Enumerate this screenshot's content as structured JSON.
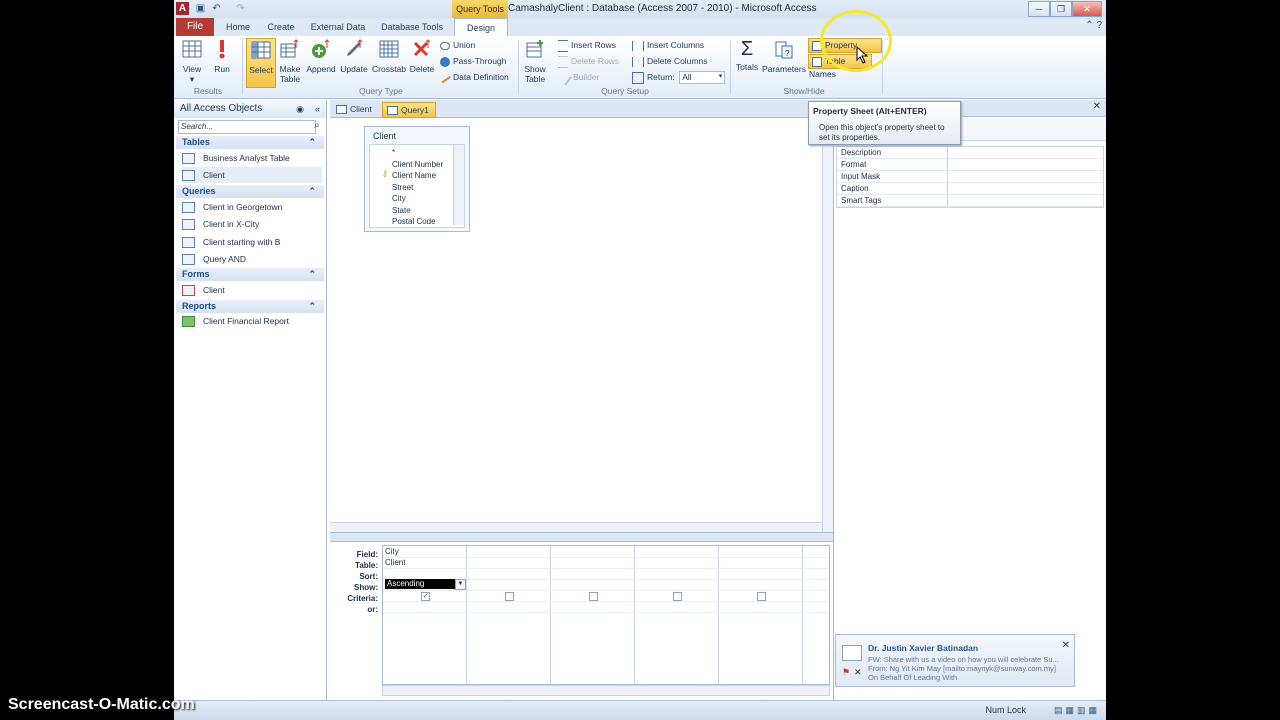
{
  "titlebar": {
    "app_letter": "A",
    "context_tab_header": "Query Tools",
    "window_title": "CamashalyClient : Database (Access 2007 - 2010) - Microsoft Access",
    "qat_save": "▣",
    "qat_undo": "↶",
    "qat_redo": "↷",
    "minimize": "─",
    "maximize": "❐",
    "close": "✕"
  },
  "tabs": {
    "file": "File",
    "items": [
      "Home",
      "Create",
      "External Data",
      "Database Tools",
      "Design"
    ]
  },
  "ribbon": {
    "results": {
      "label": "Results",
      "view": "View",
      "run": "Run"
    },
    "query_type": {
      "label": "Query Type",
      "select": "Select",
      "make_table_1": "Make",
      "make_table_2": "Table",
      "append": "Append",
      "update": "Update",
      "crosstab": "Crosstab",
      "delete": "Delete",
      "union": "Union",
      "pass_through": "Pass-Through",
      "data_definition": "Data Definition"
    },
    "query_setup": {
      "label": "Query Setup",
      "show_table_1": "Show",
      "show_table_2": "Table",
      "insert_rows": "Insert Rows",
      "delete_rows": "Delete Rows",
      "builder": "Builder",
      "insert_columns": "Insert Columns",
      "delete_columns": "Delete Columns",
      "return_label": "Return:",
      "return_value": "All"
    },
    "show_hide": {
      "label": "Show/Hide",
      "totals": "Totals",
      "parameters": "Parameters",
      "property_sheet": "Property Sheet",
      "table_names": "Table Names"
    }
  },
  "tooltip": {
    "title": "Property Sheet (Alt+ENTER)",
    "description": "Open this object's property sheet to set its properties."
  },
  "nav": {
    "header": "All Access Objects",
    "search_placeholder": "Search...",
    "groups": {
      "tables": "Tables",
      "queries": "Queries",
      "forms": "Forms",
      "reports": "Reports"
    },
    "tables": [
      "Business Analyst Table",
      "Client"
    ],
    "queries": [
      "Client in Georgetown",
      "Client in X-City",
      "Client starting with B",
      "Query AND"
    ],
    "forms": [
      "Client"
    ],
    "reports": [
      "Client Financial Report"
    ]
  },
  "doc_tabs": [
    "Client",
    "Query1"
  ],
  "field_list": {
    "title": "Client",
    "fields": [
      "*",
      "Client Number",
      "Client Name",
      "Street",
      "City",
      "State",
      "Postal Code"
    ]
  },
  "grid": {
    "row_labels": [
      "Field:",
      "Table:",
      "Sort:",
      "Show:",
      "Criteria:",
      "or:"
    ],
    "field": "City",
    "table": "Client",
    "sort": "Ascending",
    "show_checked": "✓"
  },
  "property_sheet": {
    "rows": [
      "Description",
      "Format",
      "Input Mask",
      "Caption",
      "Smart Tags"
    ],
    "close": "✕"
  },
  "notification": {
    "sender": "Dr. Justin Xavier Batinadan",
    "line1": "FW: Share with us a video on how you will celebrate Su...",
    "line2": "From: Ng Yit Kim May [mailto:maynyk@sunway.com.my]",
    "line3": "On Behalf Of Leading With",
    "close": "✕"
  },
  "status": {
    "num_lock": "Num Lock"
  },
  "watermark": "Screencast-O-Matic.com"
}
